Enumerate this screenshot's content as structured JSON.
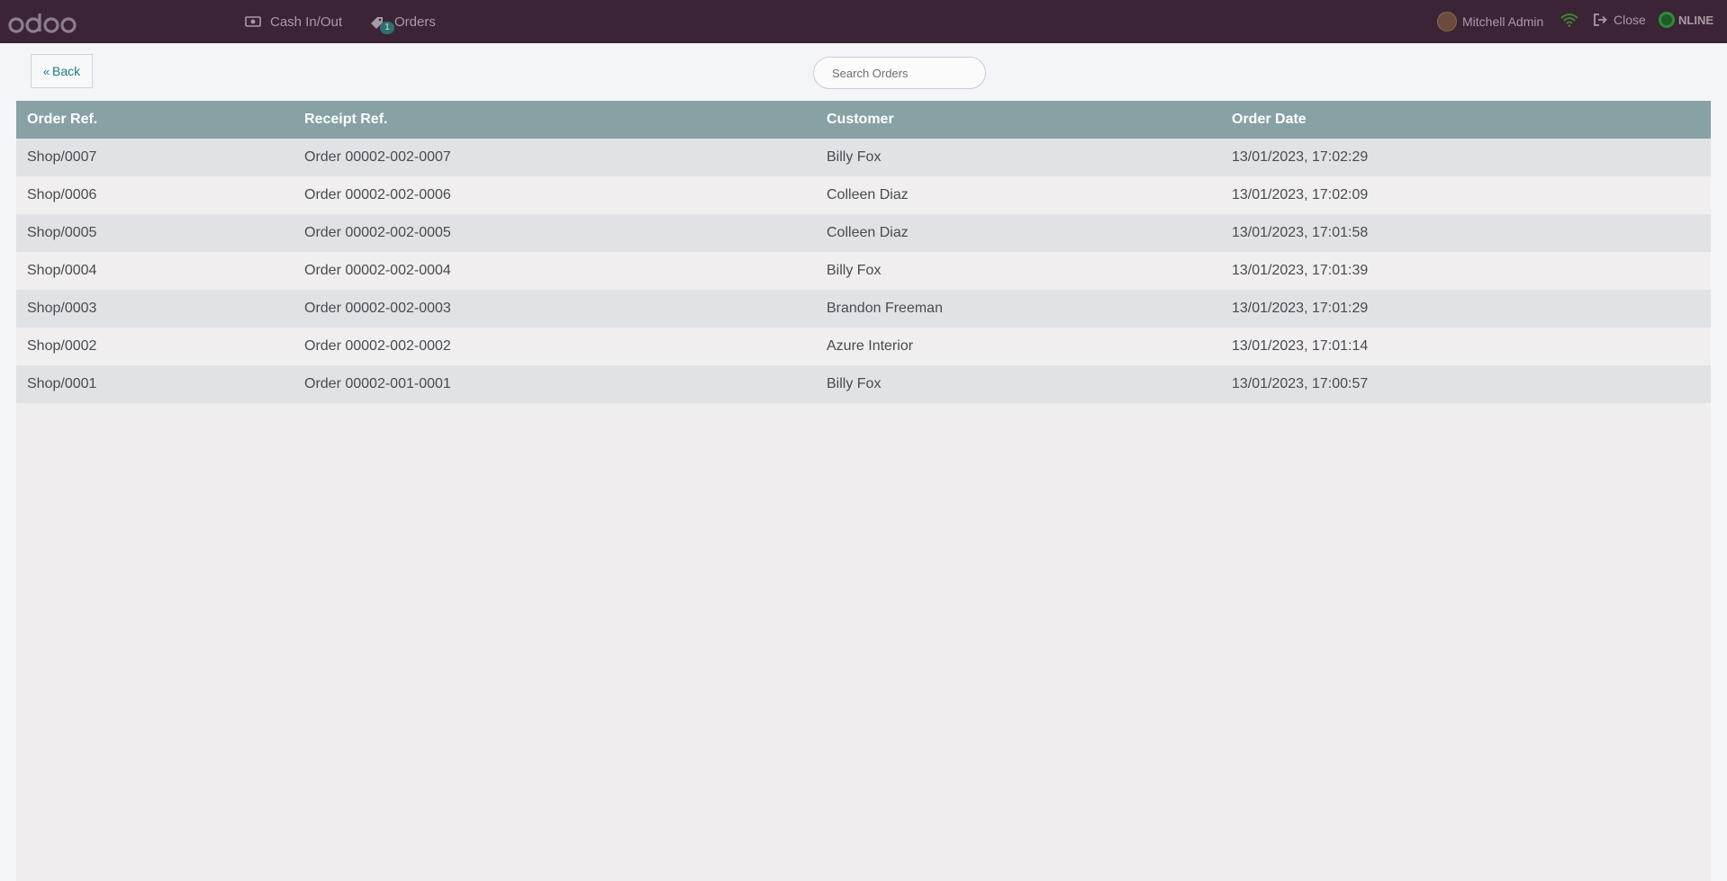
{
  "topbar": {
    "cash_label": "Cash In/Out",
    "orders_label": "Orders",
    "orders_badge": "1",
    "user_name": "Mitchell Admin",
    "close_label": "Close",
    "status_label": "NLINE"
  },
  "controls": {
    "back_label": "Back",
    "search_placeholder": "Search Orders"
  },
  "table": {
    "headers": [
      "Order Ref.",
      "Receipt Ref.",
      "Customer",
      "Order Date"
    ],
    "rows": [
      [
        "Shop/0007",
        "Order 00002-002-0007",
        "Billy Fox",
        "13/01/2023, 17:02:29"
      ],
      [
        "Shop/0006",
        "Order 00002-002-0006",
        "Colleen Diaz",
        "13/01/2023, 17:02:09"
      ],
      [
        "Shop/0005",
        "Order 00002-002-0005",
        "Colleen Diaz",
        "13/01/2023, 17:01:58"
      ],
      [
        "Shop/0004",
        "Order 00002-002-0004",
        "Billy Fox",
        "13/01/2023, 17:01:39"
      ],
      [
        "Shop/0003",
        "Order 00002-002-0003",
        "Brandon Freeman",
        "13/01/2023, 17:01:29"
      ],
      [
        "Shop/0002",
        "Order 00002-002-0002",
        "Azure Interior",
        "13/01/2023, 17:01:14"
      ],
      [
        "Shop/0001",
        "Order 00002-001-0001",
        "Billy Fox",
        "13/01/2023, 17:00:57"
      ]
    ]
  },
  "colors": {
    "topbar": "#3b2436",
    "table_header": "#87a1a5",
    "accent": "#1d7b80",
    "online": "#2f8a3a"
  },
  "icons": [
    "odoo-logo",
    "money-icon",
    "tag-icon",
    "wifi-icon",
    "sign-out-icon",
    "online-status-icon",
    "double-chevron-left-icon"
  ]
}
